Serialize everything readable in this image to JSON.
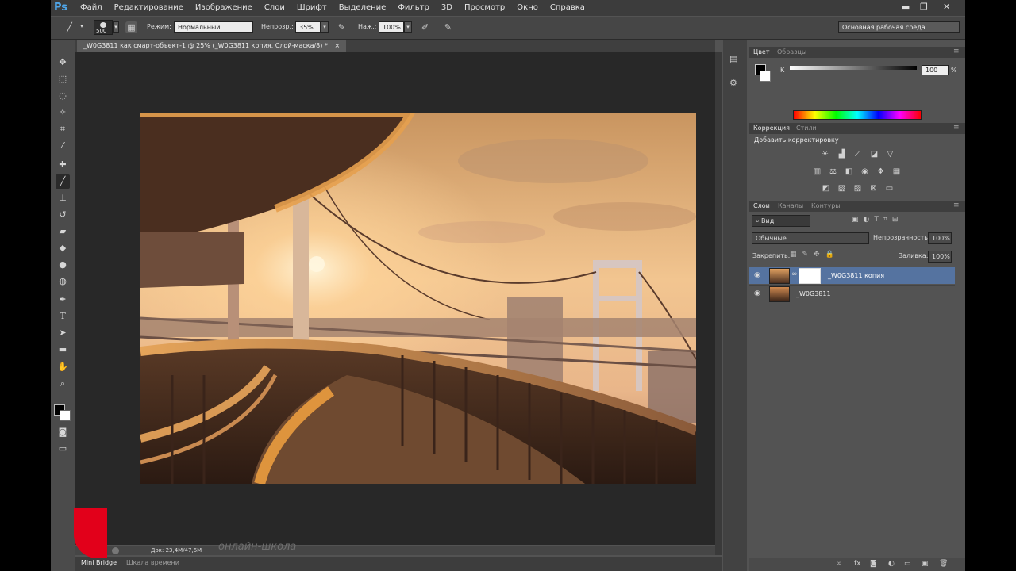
{
  "app": {
    "name": "Ps"
  },
  "menu": [
    "Файл",
    "Редактирование",
    "Изображение",
    "Слои",
    "Шрифт",
    "Выделение",
    "Фильтр",
    "3D",
    "Просмотр",
    "Окно",
    "Справка"
  ],
  "window_buttons": {
    "minimize": "▬",
    "restore": "❐",
    "close": "✕"
  },
  "options": {
    "brush_size": "500",
    "mode_label": "Режим:",
    "mode_value": "Нормальный",
    "opacity_label": "Непрозр.:",
    "opacity_value": "35%",
    "flow_label": "Наж.:",
    "flow_value": "100%",
    "workspace": "Основная рабочая среда"
  },
  "document": {
    "tab_title": "_W0G3811 как смарт-объект-1 @ 25% (_W0G3811 копия, Слой-маска/8) *",
    "tab_close": "×",
    "status": "Док: 23,4M/47,6M",
    "watermark": "онлайн-школа"
  },
  "bottom_tabs": [
    "Mini Bridge",
    "Шкала времени"
  ],
  "color_panel": {
    "tabs": [
      "Цвет",
      "Образцы"
    ],
    "channel_label": "K",
    "channel_value": "100",
    "channel_unit": "%"
  },
  "adjustments_panel": {
    "tabs": [
      "Коррекция",
      "Стили"
    ],
    "title": "Добавить корректировку"
  },
  "layers_panel": {
    "tabs": [
      "Слои",
      "Каналы",
      "Контуры"
    ],
    "filter_label": "Вид",
    "blend_mode": "Обычные",
    "opacity_label": "Непрозрачность:",
    "opacity_value": "100%",
    "lock_label": "Закрепить:",
    "fill_label": "Заливка:",
    "fill_value": "100%",
    "layers": [
      {
        "name": "_W0G3811 копия",
        "selected": true
      },
      {
        "name": "_W0G3811",
        "selected": false
      }
    ]
  },
  "colors": {
    "menubar": "#3c3c3c",
    "panel": "#535353",
    "canvas_bg": "#282828",
    "selected_layer": "#5573a0",
    "ps_blue": "#4fa5e8"
  },
  "icons": {
    "tools": [
      "move-icon",
      "marquee-icon",
      "lasso-icon",
      "quick-select-icon",
      "crop-icon",
      "eyedropper-icon",
      "healing-icon",
      "brush-icon",
      "stamp-icon",
      "history-brush-icon",
      "eraser-icon",
      "gradient-icon",
      "blur-icon",
      "dodge-icon",
      "pen-icon",
      "type-icon",
      "path-select-icon",
      "shape-icon",
      "hand-icon",
      "zoom-icon"
    ]
  }
}
